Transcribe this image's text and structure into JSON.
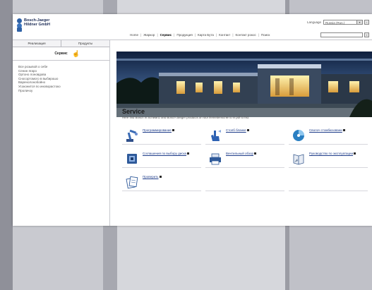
{
  "window": {
    "logo": {
      "line1": "Bosch-Jaeger",
      "line2": "Hildner GmbH"
    },
    "language": {
      "label": "Language",
      "value": "Russia (Rus.)",
      "go_label": "›"
    },
    "topnav": {
      "items": [
        {
          "label": "Home",
          "active": false
        },
        {
          "label": "Жаркор",
          "active": false
        },
        {
          "label": "Сервис",
          "active": true
        },
        {
          "label": "Продукция",
          "active": false
        },
        {
          "label": "Карта Бута",
          "active": false
        },
        {
          "label": "Контакт",
          "active": false
        },
        {
          "label": "Контакт рокос",
          "active": false
        },
        {
          "label": "Поиск",
          "active": false
        }
      ],
      "separator": "|"
    },
    "search": {
      "placeholder": "",
      "button_label": "›"
    }
  },
  "sidebar": {
    "tabs": [
      {
        "label": "Реализация"
      },
      {
        "label": "Продукты"
      }
    ],
    "title": "Сервис",
    "items": [
      {
        "label": "Все розывой о себе"
      },
      {
        "label": "Сенин ягаpo"
      },
      {
        "label": "Ортоно лоновдова"
      },
      {
        "label": "Сносортомого в выбирошо"
      },
      {
        "label": "Варенолонобойно"
      },
      {
        "label": "Усоконится по иноворастоко"
      },
      {
        "label": "Пролачоу"
      }
    ]
  },
  "main": {
    "title": "Service",
    "description": "Here find Bosch in Schwartz and Bosch-Jaeger products on stor flemettenschie lo in pdf to hid.",
    "services": [
      {
        "label": "Программирование",
        "icon": "robot-arm-icon"
      },
      {
        "label": "Столб бланке",
        "icon": "hand-point-icon"
      },
      {
        "label": "Сволоч стомбюзовани",
        "icon": "disc-icon"
      },
      {
        "label": "Соглашения по выбору диска",
        "icon": "screen-icon"
      },
      {
        "label": "Вентильный обзор",
        "icon": "printer-icon"
      },
      {
        "label": "Руководство по эксплуатации",
        "icon": "manual-icon"
      },
      {
        "label": "Проверить",
        "icon": "documents-icon"
      }
    ]
  }
}
